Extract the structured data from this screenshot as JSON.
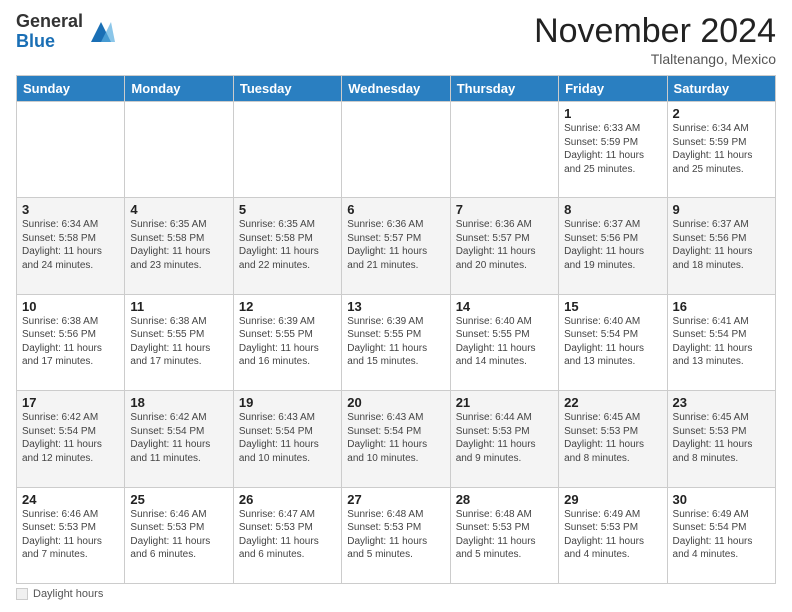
{
  "logo": {
    "general": "General",
    "blue": "Blue"
  },
  "header": {
    "month": "November 2024",
    "location": "Tlaltenango, Mexico"
  },
  "weekdays": [
    "Sunday",
    "Monday",
    "Tuesday",
    "Wednesday",
    "Thursday",
    "Friday",
    "Saturday"
  ],
  "weeks": [
    [
      {
        "day": "",
        "info": ""
      },
      {
        "day": "",
        "info": ""
      },
      {
        "day": "",
        "info": ""
      },
      {
        "day": "",
        "info": ""
      },
      {
        "day": "",
        "info": ""
      },
      {
        "day": "1",
        "info": "Sunrise: 6:33 AM\nSunset: 5:59 PM\nDaylight: 11 hours and 25 minutes."
      },
      {
        "day": "2",
        "info": "Sunrise: 6:34 AM\nSunset: 5:59 PM\nDaylight: 11 hours and 25 minutes."
      }
    ],
    [
      {
        "day": "3",
        "info": "Sunrise: 6:34 AM\nSunset: 5:58 PM\nDaylight: 11 hours and 24 minutes."
      },
      {
        "day": "4",
        "info": "Sunrise: 6:35 AM\nSunset: 5:58 PM\nDaylight: 11 hours and 23 minutes."
      },
      {
        "day": "5",
        "info": "Sunrise: 6:35 AM\nSunset: 5:58 PM\nDaylight: 11 hours and 22 minutes."
      },
      {
        "day": "6",
        "info": "Sunrise: 6:36 AM\nSunset: 5:57 PM\nDaylight: 11 hours and 21 minutes."
      },
      {
        "day": "7",
        "info": "Sunrise: 6:36 AM\nSunset: 5:57 PM\nDaylight: 11 hours and 20 minutes."
      },
      {
        "day": "8",
        "info": "Sunrise: 6:37 AM\nSunset: 5:56 PM\nDaylight: 11 hours and 19 minutes."
      },
      {
        "day": "9",
        "info": "Sunrise: 6:37 AM\nSunset: 5:56 PM\nDaylight: 11 hours and 18 minutes."
      }
    ],
    [
      {
        "day": "10",
        "info": "Sunrise: 6:38 AM\nSunset: 5:56 PM\nDaylight: 11 hours and 17 minutes."
      },
      {
        "day": "11",
        "info": "Sunrise: 6:38 AM\nSunset: 5:55 PM\nDaylight: 11 hours and 17 minutes."
      },
      {
        "day": "12",
        "info": "Sunrise: 6:39 AM\nSunset: 5:55 PM\nDaylight: 11 hours and 16 minutes."
      },
      {
        "day": "13",
        "info": "Sunrise: 6:39 AM\nSunset: 5:55 PM\nDaylight: 11 hours and 15 minutes."
      },
      {
        "day": "14",
        "info": "Sunrise: 6:40 AM\nSunset: 5:55 PM\nDaylight: 11 hours and 14 minutes."
      },
      {
        "day": "15",
        "info": "Sunrise: 6:40 AM\nSunset: 5:54 PM\nDaylight: 11 hours and 13 minutes."
      },
      {
        "day": "16",
        "info": "Sunrise: 6:41 AM\nSunset: 5:54 PM\nDaylight: 11 hours and 13 minutes."
      }
    ],
    [
      {
        "day": "17",
        "info": "Sunrise: 6:42 AM\nSunset: 5:54 PM\nDaylight: 11 hours and 12 minutes."
      },
      {
        "day": "18",
        "info": "Sunrise: 6:42 AM\nSunset: 5:54 PM\nDaylight: 11 hours and 11 minutes."
      },
      {
        "day": "19",
        "info": "Sunrise: 6:43 AM\nSunset: 5:54 PM\nDaylight: 11 hours and 10 minutes."
      },
      {
        "day": "20",
        "info": "Sunrise: 6:43 AM\nSunset: 5:54 PM\nDaylight: 11 hours and 10 minutes."
      },
      {
        "day": "21",
        "info": "Sunrise: 6:44 AM\nSunset: 5:53 PM\nDaylight: 11 hours and 9 minutes."
      },
      {
        "day": "22",
        "info": "Sunrise: 6:45 AM\nSunset: 5:53 PM\nDaylight: 11 hours and 8 minutes."
      },
      {
        "day": "23",
        "info": "Sunrise: 6:45 AM\nSunset: 5:53 PM\nDaylight: 11 hours and 8 minutes."
      }
    ],
    [
      {
        "day": "24",
        "info": "Sunrise: 6:46 AM\nSunset: 5:53 PM\nDaylight: 11 hours and 7 minutes."
      },
      {
        "day": "25",
        "info": "Sunrise: 6:46 AM\nSunset: 5:53 PM\nDaylight: 11 hours and 6 minutes."
      },
      {
        "day": "26",
        "info": "Sunrise: 6:47 AM\nSunset: 5:53 PM\nDaylight: 11 hours and 6 minutes."
      },
      {
        "day": "27",
        "info": "Sunrise: 6:48 AM\nSunset: 5:53 PM\nDaylight: 11 hours and 5 minutes."
      },
      {
        "day": "28",
        "info": "Sunrise: 6:48 AM\nSunset: 5:53 PM\nDaylight: 11 hours and 5 minutes."
      },
      {
        "day": "29",
        "info": "Sunrise: 6:49 AM\nSunset: 5:53 PM\nDaylight: 11 hours and 4 minutes."
      },
      {
        "day": "30",
        "info": "Sunrise: 6:49 AM\nSunset: 5:54 PM\nDaylight: 11 hours and 4 minutes."
      }
    ]
  ],
  "footer": {
    "label": "Daylight hours"
  }
}
